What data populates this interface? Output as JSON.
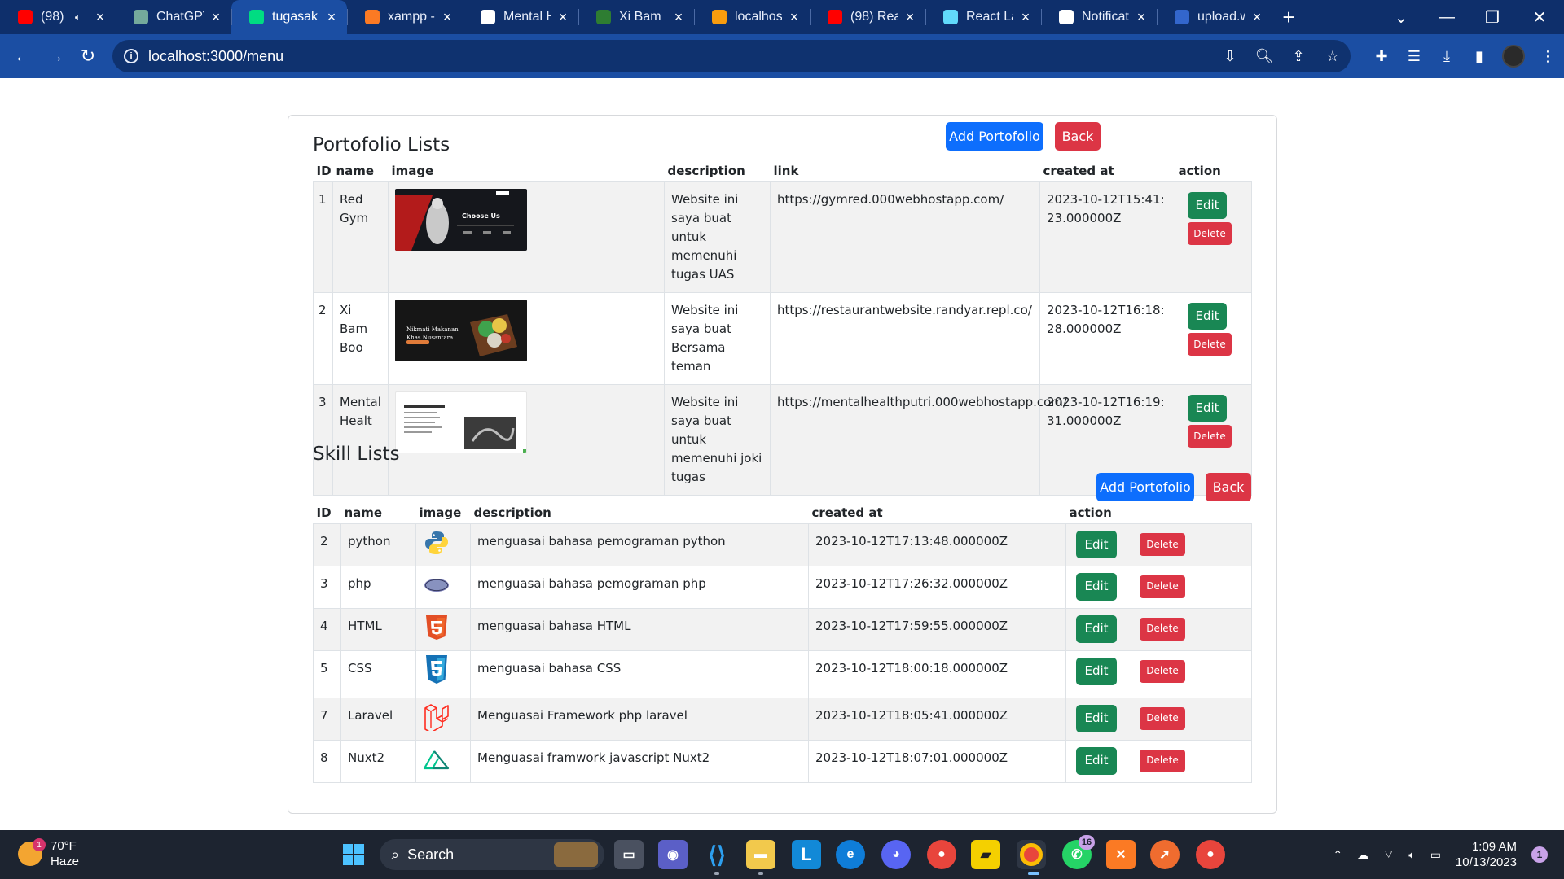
{
  "browser": {
    "tabs": [
      {
        "title": "(98)",
        "favicon": "youtube-icon",
        "color": "#ff0000",
        "audio": true
      },
      {
        "title": "ChatGPT",
        "favicon": "chatgpt-icon",
        "color": "#74aa9c"
      },
      {
        "title": "tugasakh",
        "favicon": "nuxt-icon",
        "color": "#00dc82",
        "active": true
      },
      {
        "title": "xampp -",
        "favicon": "xampp-icon",
        "color": "#fb7a24"
      },
      {
        "title": "Mental H",
        "favicon": "page-icon",
        "color": "#ffffff"
      },
      {
        "title": "Xi Bam B",
        "favicon": "leaf-icon",
        "color": "#2e7d32"
      },
      {
        "title": "localhost",
        "favicon": "phpmyadmin-icon",
        "color": "#f89c0e"
      },
      {
        "title": "(98) Rea",
        "favicon": "youtube-icon",
        "color": "#ff0000"
      },
      {
        "title": "React La",
        "favicon": "react-icon",
        "color": "#61dafb"
      },
      {
        "title": "Notificat",
        "favicon": "github-icon",
        "color": "#ffffff"
      },
      {
        "title": "upload.w",
        "favicon": "wikimedia-icon",
        "color": "#36c"
      }
    ],
    "url": "localhost:3000/menu"
  },
  "portfolio": {
    "heading": "Portofolio Lists",
    "add_label": "Add Portofolio",
    "back_label": "Back",
    "headers": {
      "id": "ID",
      "name": "name",
      "image": "image",
      "description": "description",
      "link": "link",
      "created": "created at",
      "action": "action"
    },
    "rows": [
      {
        "id": "1",
        "name": "Red Gym",
        "description": "Website ini saya buat untuk memenuhi tugas UAS",
        "link": "https://gymred.000webhostapp.com/",
        "created": "2023-10-12T15:41:23.000000Z",
        "thumb": "gym",
        "edit": "Edit",
        "delete": "Delete"
      },
      {
        "id": "2",
        "name": "Xi Bam Boo",
        "description": "Website ini saya buat Bersama teman",
        "link": "https://restaurantwebsite.randyar.repl.co/",
        "created": "2023-10-12T16:18:28.000000Z",
        "thumb": "food",
        "edit": "Edit",
        "delete": "Delete"
      },
      {
        "id": "3",
        "name": "Mental Healt",
        "description": "Website ini saya buat untuk memenuhi joki tugas",
        "link": "https://mentalhealthputri.000webhostapp.com/",
        "created": "2023-10-12T16:19:31.000000Z",
        "thumb": "mental",
        "edit": "Edit",
        "delete": "Delete"
      }
    ],
    "thumb_text": {
      "gym": "Choose Us",
      "food_line1": "Nikmati Makanan",
      "food_line2": "Khas Nusantara"
    }
  },
  "skills": {
    "heading": "Skill Lists",
    "add_label": "Add Portofolio",
    "back_label": "Back",
    "headers": {
      "id": "ID",
      "name": "name",
      "image": "image",
      "description": "description",
      "created": "created at",
      "action": "action"
    },
    "rows": [
      {
        "id": "2",
        "name": "python",
        "icon": "python-icon",
        "description": "menguasai bahasa pemograman python",
        "created": "2023-10-12T17:13:48.000000Z",
        "edit": "Edit",
        "delete": "Delete"
      },
      {
        "id": "3",
        "name": "php",
        "icon": "php-icon",
        "description": "menguasai bahasa pemograman php",
        "created": "2023-10-12T17:26:32.000000Z",
        "edit": "Edit",
        "delete": "Delete"
      },
      {
        "id": "4",
        "name": "HTML",
        "icon": "html5-icon",
        "description": "menguasai bahasa HTML",
        "created": "2023-10-12T17:59:55.000000Z",
        "edit": "Edit",
        "delete": "Delete"
      },
      {
        "id": "5",
        "name": "CSS",
        "icon": "css3-icon",
        "description": "menguasai bahasa CSS",
        "created": "2023-10-12T18:00:18.000000Z",
        "edit": "Edit",
        "delete": "Delete"
      },
      {
        "id": "7",
        "name": "Laravel",
        "icon": "laravel-icon",
        "description": "Menguasai Framework php laravel",
        "created": "2023-10-12T18:05:41.000000Z",
        "edit": "Edit",
        "delete": "Delete"
      },
      {
        "id": "8",
        "name": "Nuxt2",
        "icon": "nuxt-icon",
        "description": "Menguasai framwork javascript Nuxt2",
        "created": "2023-10-12T18:07:01.000000Z",
        "edit": "Edit",
        "delete": "Delete"
      }
    ]
  },
  "taskbar": {
    "weather_temp": "70°F",
    "weather_desc": "Haze",
    "weather_badge": "1",
    "search_placeholder": "Search",
    "whatsapp_badge": "16",
    "time": "1:09 AM",
    "date": "10/13/2023",
    "notification_count": "1"
  },
  "colors": {
    "primary": "#0d6efd",
    "danger": "#dc3545",
    "success": "#198754",
    "chrome": "#1b4ea3"
  }
}
